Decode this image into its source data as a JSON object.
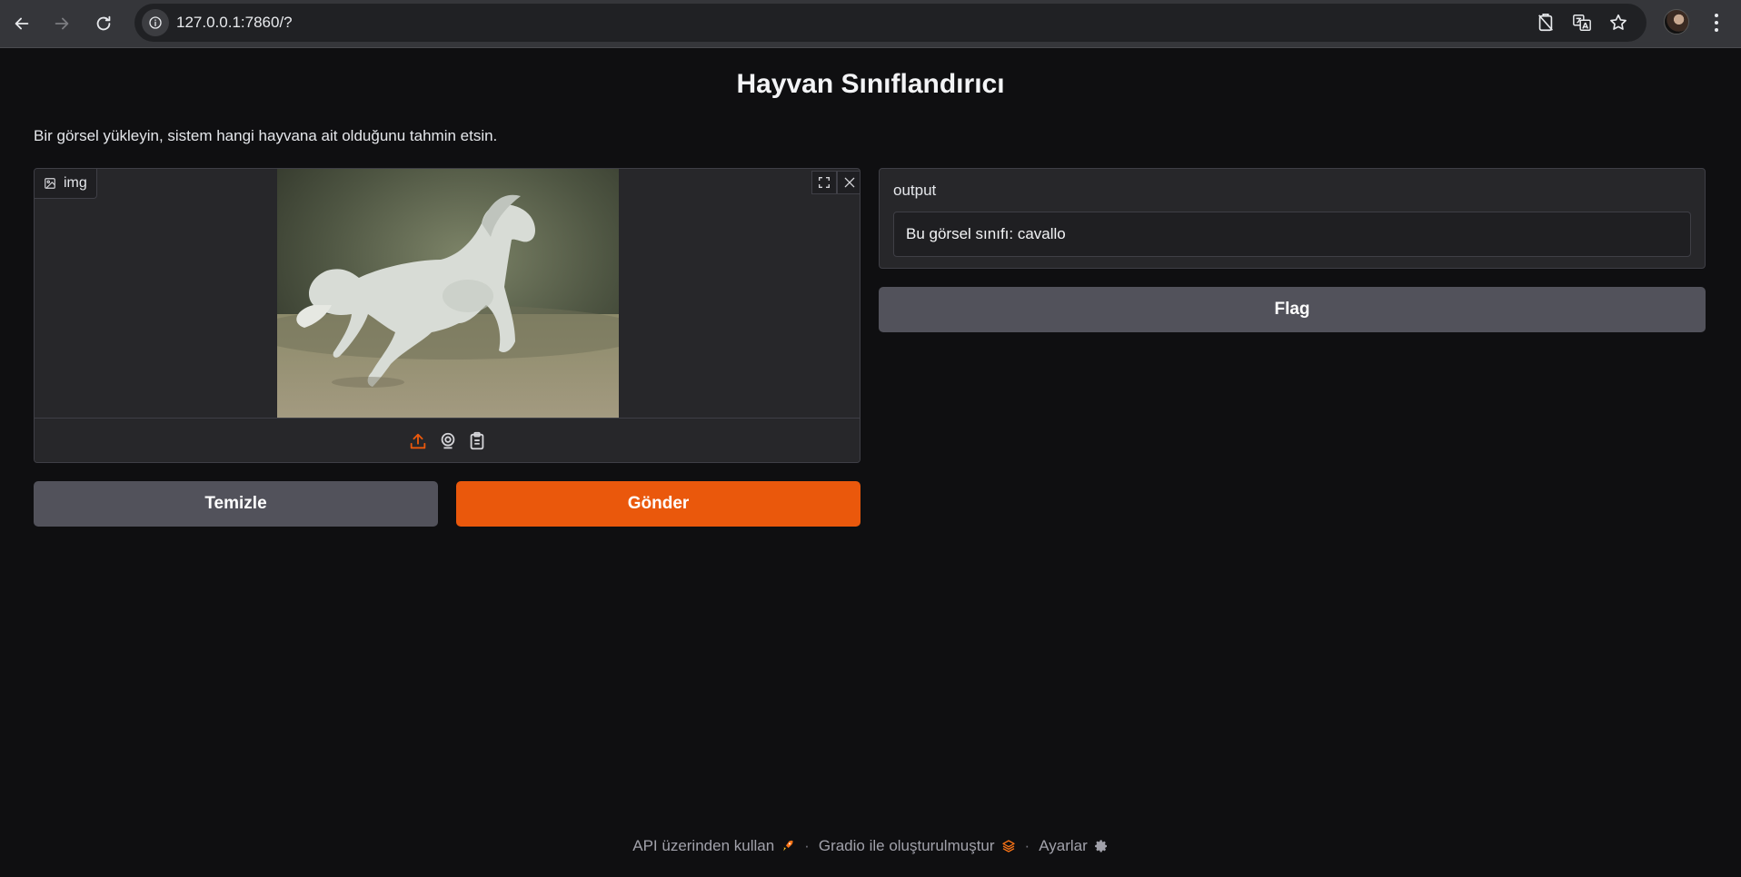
{
  "browser": {
    "url": "127.0.0.1:7860/?"
  },
  "app": {
    "title": "Hayvan Sınıflandırıcı",
    "description": "Bir görsel yükleyin, sistem hangi hayvana ait olduğunu tahmin etsin."
  },
  "image_input": {
    "label": "img"
  },
  "buttons": {
    "clear": "Temizle",
    "submit": "Gönder",
    "flag": "Flag"
  },
  "output": {
    "label": "output",
    "value": "Bu görsel sınıfı: cavallo"
  },
  "footer": {
    "api": "API üzerinden kullan",
    "separator": "·",
    "built_with": "Gradio ile oluşturulmuştur",
    "settings": "Ayarlar"
  },
  "colors": {
    "accent": "#ea580c",
    "background": "#0f0f11",
    "panel": "#27272a",
    "secondary_button": "#52525b"
  }
}
